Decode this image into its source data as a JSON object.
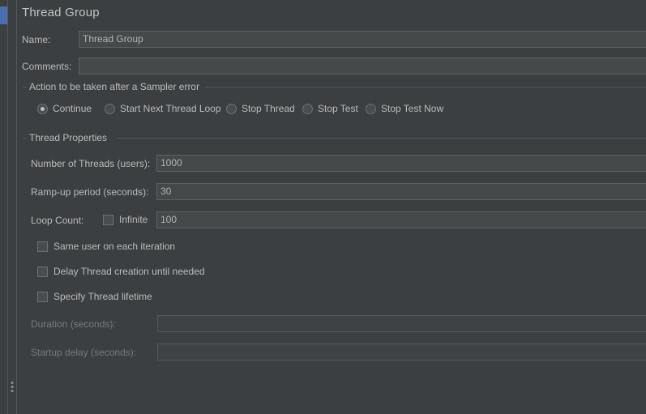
{
  "panel": {
    "title": "Thread Group"
  },
  "name_row": {
    "label": "Name:",
    "value": "Thread Group"
  },
  "comments_row": {
    "label": "Comments:",
    "value": ""
  },
  "error_action": {
    "group_title": "Action to be taken after a Sampler error",
    "options": [
      {
        "label": "Continue",
        "checked": true
      },
      {
        "label": "Start Next Thread Loop",
        "checked": false
      },
      {
        "label": "Stop Thread",
        "checked": false
      },
      {
        "label": "Stop Test",
        "checked": false
      },
      {
        "label": "Stop Test Now",
        "checked": false
      }
    ]
  },
  "thread_properties": {
    "group_title": "Thread Properties",
    "num_threads": {
      "label": "Number of Threads (users):",
      "value": "1000"
    },
    "ramp_up": {
      "label": "Ramp-up period (seconds):",
      "value": "30"
    },
    "loop_count": {
      "label": "Loop Count:",
      "infinite_label": "Infinite",
      "infinite_checked": false,
      "value": "100"
    },
    "checkboxes": [
      {
        "label": "Same user on each iteration",
        "checked": false
      },
      {
        "label": "Delay Thread creation until needed",
        "checked": false
      },
      {
        "label": "Specify Thread lifetime",
        "checked": false
      }
    ],
    "duration": {
      "label": "Duration (seconds):",
      "value": "",
      "disabled": true
    },
    "startup_delay": {
      "label": "Startup delay (seconds):",
      "value": "",
      "disabled": true
    }
  },
  "colors": {
    "panel_background": "#3c3f41",
    "input_background": "#45494a",
    "border": "#5e6060",
    "text": "#bbbbbb",
    "disabled_text": "#777a7c",
    "selection_accent": "#4b6eaf"
  }
}
